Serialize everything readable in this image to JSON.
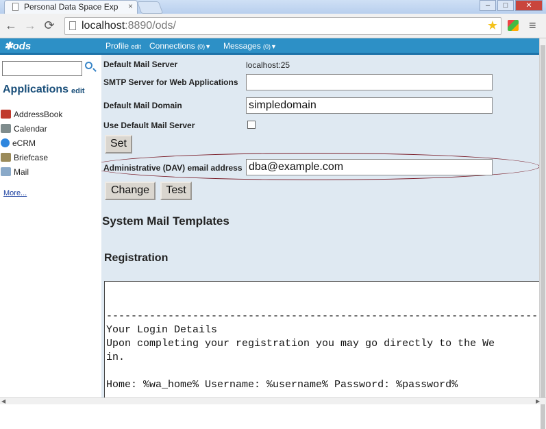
{
  "browser": {
    "tab_title": "Personal Data Space Exp",
    "tab_close": "×",
    "url_host": "localhost",
    "url_port_path": ":8890/ods/",
    "back": "←",
    "forward": "→",
    "reload": "⟳",
    "star": "★",
    "menu": "≡",
    "win_min": "–",
    "win_max": "□",
    "win_close": "✕"
  },
  "appbar": {
    "logo": "ods",
    "profile": "Profile",
    "profile_edit": "edit",
    "connections": "Connections",
    "connections_count": "(0)",
    "messages": "Messages",
    "messages_count": "(0)",
    "arrow": "▼"
  },
  "sidebar": {
    "search_value": "",
    "apps_title": "Applications",
    "apps_edit": "edit",
    "items": [
      {
        "label": "AddressBook",
        "icon": "addressbook-icon",
        "color": "#c0392b"
      },
      {
        "label": "Calendar",
        "icon": "calendar-icon",
        "color": "#7f8c8d"
      },
      {
        "label": "eCRM",
        "icon": "ecrm-icon",
        "color": "#2e86de"
      },
      {
        "label": "Briefcase",
        "icon": "briefcase-icon",
        "color": "#9b8b5a"
      },
      {
        "label": "Mail",
        "icon": "mail-icon",
        "color": "#8aa9c8"
      }
    ],
    "more": "More..."
  },
  "form": {
    "default_mail_server_label": "Default Mail Server",
    "default_mail_server_value": "localhost:25",
    "smtp_label": "SMTP Server for Web Applications",
    "smtp_value": "",
    "domain_label": "Default Mail Domain",
    "domain_value": "simpledomain",
    "use_default_label": "Use Default Mail Server",
    "use_default_checked": false,
    "set_button": "Set",
    "admin_email_label": "Administrative (DAV) email address",
    "admin_email_value": "dba@example.com",
    "change_button": "Change",
    "test_button": "Test"
  },
  "templates": {
    "section_title": "System Mail Templates",
    "subsection_title": "Registration",
    "lines": [
      "",
      "",
      "------------------------------------------------------------------------------------",
      "Your Login Details",
      "Upon completing your registration you may go directly to the We",
      "in.",
      "",
      "Home: %wa_home% Username: %username% Password: %password%"
    ]
  }
}
